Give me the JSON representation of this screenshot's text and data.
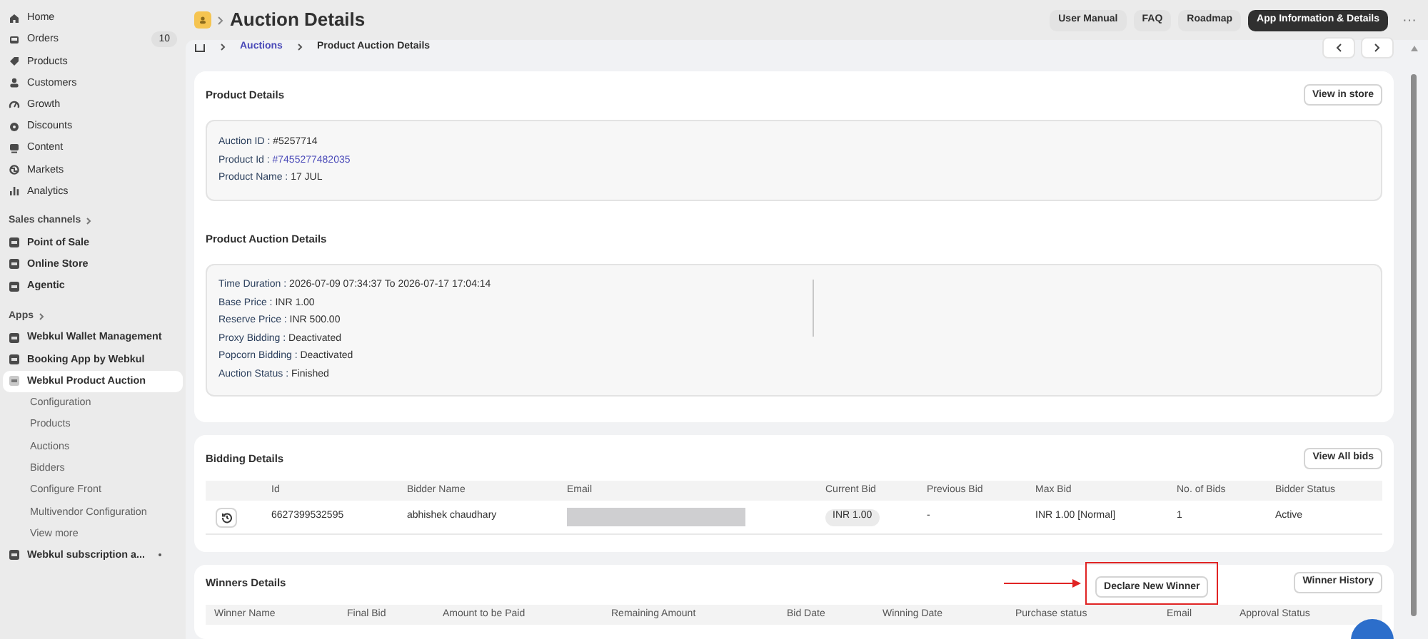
{
  "sidebar": {
    "sections": [
      {
        "items": [
          {
            "label": "Home",
            "selected": false
          },
          {
            "label": "Orders",
            "badge": "10",
            "selected": false
          },
          {
            "label": "Products",
            "selected": false
          },
          {
            "label": "Customers",
            "selected": false
          },
          {
            "label": "Growth",
            "selected": false
          },
          {
            "label": "Discounts",
            "selected": false
          },
          {
            "label": "Content",
            "selected": false
          },
          {
            "label": "Markets",
            "selected": false
          },
          {
            "label": "Analytics",
            "selected": false
          }
        ]
      },
      {
        "heading": "Sales channels",
        "items": [
          {
            "label": "Point of Sale",
            "selected": false
          },
          {
            "label": "Online Store",
            "selected": false
          },
          {
            "label": "Agentic",
            "selected": false
          }
        ]
      },
      {
        "heading": "Apps",
        "items": [
          {
            "label": "Webkul Wallet Management",
            "selected": false
          },
          {
            "label": "Booking App by Webkul",
            "selected": false
          },
          {
            "label": "Webkul Product Auction",
            "selected": true,
            "children": [
              {
                "label": "Configuration"
              },
              {
                "label": "Products"
              },
              {
                "label": "Auctions"
              },
              {
                "label": "Bidders"
              },
              {
                "label": "Configure Front"
              },
              {
                "label": "Multivendor Configuration"
              },
              {
                "label": "View more"
              }
            ]
          },
          {
            "label": "Webkul subscription a...",
            "selected": false,
            "dot": true
          }
        ]
      }
    ]
  },
  "header": {
    "title": "Auction Details",
    "buttons": [
      {
        "label": "User Manual",
        "primary": false
      },
      {
        "label": "FAQ",
        "primary": false
      },
      {
        "label": "Roadmap",
        "primary": false
      },
      {
        "label": "App Information & Details",
        "primary": true
      }
    ],
    "more": "···"
  },
  "breadcrumb": [
    {
      "label": "Auctions",
      "link": true
    },
    {
      "label": "Product Auction Details",
      "link": false
    }
  ],
  "product_details": {
    "title": "Product Details",
    "button": "View in store",
    "fields": [
      {
        "label": "Auction ID : ",
        "value": "#5257714",
        "link": false
      },
      {
        "label": "Product Id : ",
        "value": "#7455277482035",
        "link": true
      },
      {
        "label": "Product Name : ",
        "value": "17 JUL",
        "link": false
      }
    ]
  },
  "auction_details": {
    "title": "Product Auction Details",
    "fields": [
      {
        "label": "Time Duration : ",
        "value": "2026-07-09 07:34:37 To 2026-07-17 17:04:14",
        "link": false
      },
      {
        "label": "Base Price : ",
        "value": "INR 1.00",
        "link": false
      },
      {
        "label": "Reserve Price : ",
        "value": "INR 500.00",
        "link": false
      },
      {
        "label": "Proxy Bidding : ",
        "value": "Deactivated",
        "link": false
      },
      {
        "label": "Popcorn Bidding : ",
        "value": "Deactivated",
        "link": false
      },
      {
        "label": "Auction Status : ",
        "value": "Finished",
        "link": false
      }
    ]
  },
  "bidding": {
    "title": "Bidding Details",
    "button": "View All bids",
    "columns": [
      "",
      "Id",
      "Bidder Name",
      "Email",
      "Current Bid",
      "Previous Bid",
      "Max Bid",
      "No. of Bids",
      "Bidder Status"
    ],
    "rows": [
      {
        "cells": [
          {
            "kind": "icon"
          },
          {
            "kind": "text",
            "text": "6627399532595"
          },
          {
            "kind": "text",
            "text": "abhishek chaudhary"
          },
          {
            "kind": "redacted"
          },
          {
            "kind": "pill",
            "text": "INR 1.00"
          },
          {
            "kind": "text",
            "text": "-"
          },
          {
            "kind": "text",
            "text": "INR 1.00 [Normal]"
          },
          {
            "kind": "text",
            "text": "1"
          },
          {
            "kind": "text",
            "text": "Active"
          }
        ]
      }
    ]
  },
  "winners": {
    "title": "Winners Details",
    "buttons": [
      {
        "label": "Declare New Winner",
        "highlighted": true
      },
      {
        "label": "Winner History",
        "highlighted": false
      }
    ],
    "columns": [
      "Winner Name",
      "Final Bid",
      "Amount to be Paid",
      "Remaining Amount",
      "Bid Date",
      "Winning Date",
      "Purchase status",
      "Email",
      "Approval Status"
    ]
  }
}
